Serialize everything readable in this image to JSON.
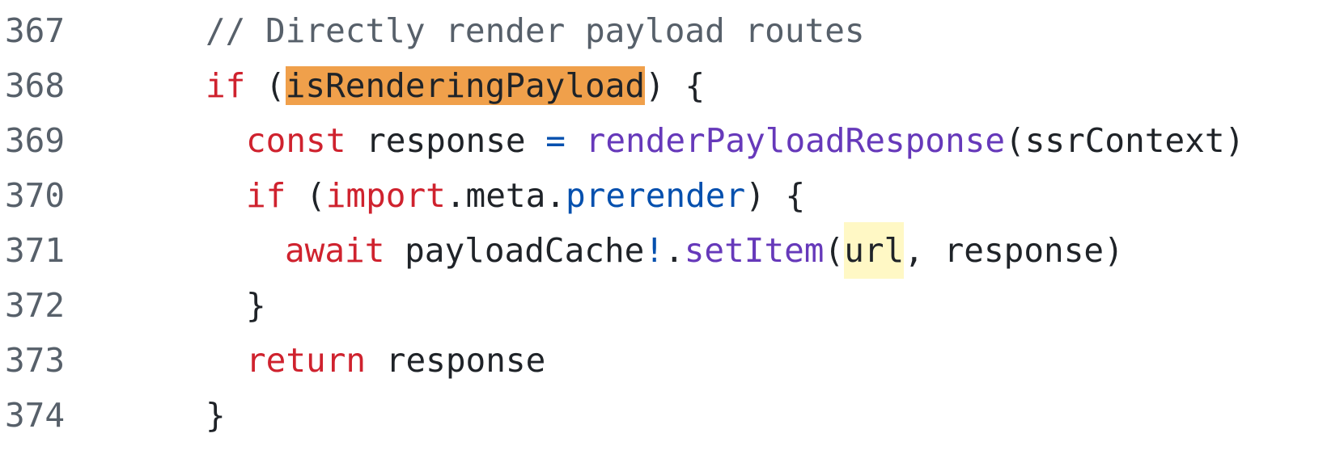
{
  "lines": [
    {
      "number": "367",
      "tokens": [
        "// Directly render payload routes"
      ]
    },
    {
      "number": "368",
      "tokens": [
        "if",
        " (",
        "isRenderingPayload",
        ") {"
      ]
    },
    {
      "number": "369",
      "tokens": [
        "const",
        " response ",
        "=",
        " ",
        "renderPayloadResponse",
        "(ssrContext)"
      ]
    },
    {
      "number": "370",
      "tokens": [
        "if",
        " (",
        "import",
        ".meta.",
        "prerender",
        ") {"
      ]
    },
    {
      "number": "371",
      "tokens": [
        "await",
        " payloadCache",
        "!",
        ".",
        "setItem",
        "(",
        "url",
        ", response)"
      ]
    },
    {
      "number": "372",
      "tokens": [
        "}"
      ]
    },
    {
      "number": "373",
      "tokens": [
        "return",
        " response"
      ]
    },
    {
      "number": "374",
      "tokens": [
        "}"
      ]
    }
  ],
  "colors": {
    "line_number": "#57606a",
    "comment": "#57606a",
    "keyword": "#cf222e",
    "function": "#6639ba",
    "property": "#0550ae",
    "search_highlight": "#f0a04b",
    "word_highlight": "#fff8c5"
  }
}
